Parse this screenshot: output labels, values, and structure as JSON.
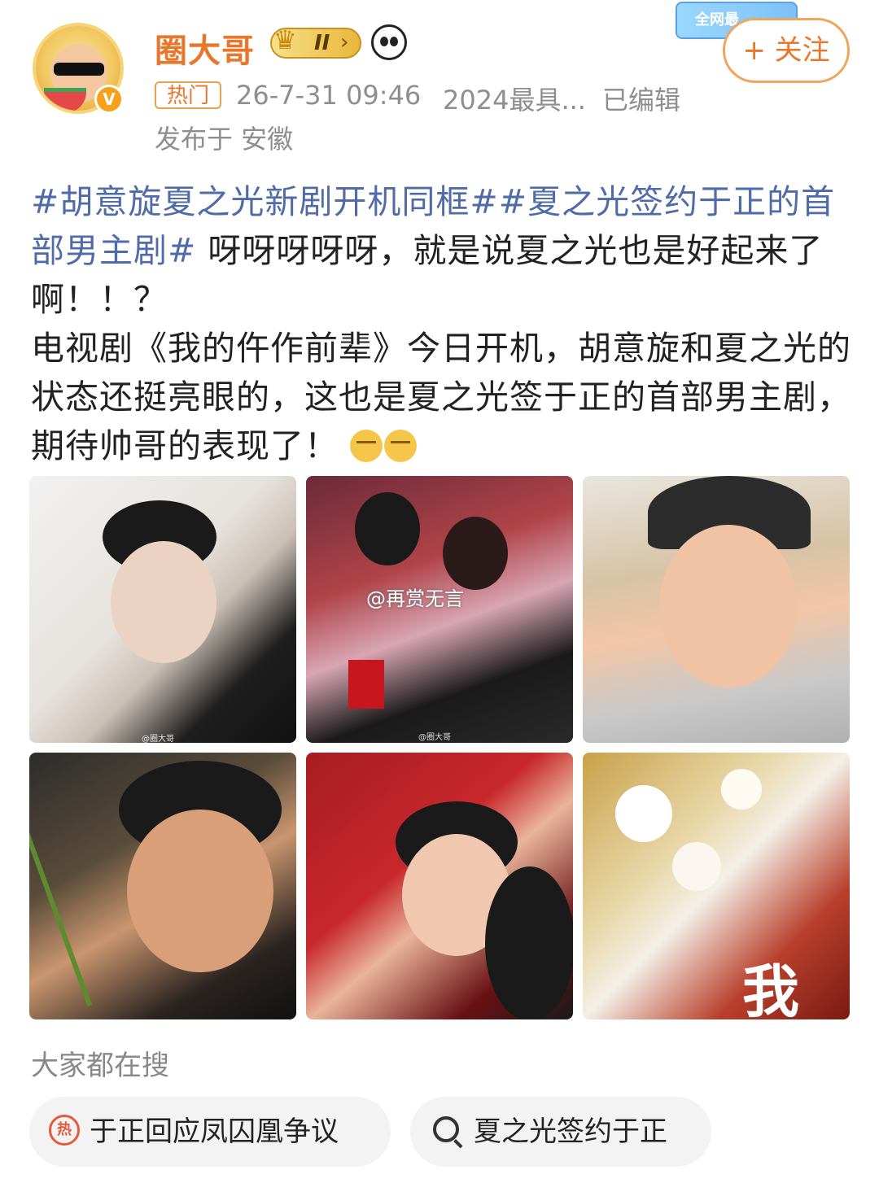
{
  "header": {
    "username": "圈大哥",
    "vip_level": "II",
    "promo_label": "全网最",
    "tag_hot": "热门",
    "timestamp": "26-7-31 09:46",
    "source": "2024最具...",
    "edited": "已编辑",
    "location": "发布于 安徽",
    "follow_label": "+ 关注"
  },
  "post": {
    "hashtag1": "#胡意旋夏之光新剧开机同框#",
    "hashtag2": "#夏之光签约于正的首部男主剧#",
    "line1_rest": " 呀呀呀呀呀，就是说夏之光也是好起来了啊！！？",
    "paragraph2": "电视剧《我的仵作前辈》今日开机，胡意旋和夏之光的状态还挺亮眼的，这也是夏之光签于正的首部男主剧，期待帅哥的表现了！"
  },
  "photos": {
    "watermark_small": "@圈大哥",
    "watermark_center": "@再赏无言",
    "poster_char": "我"
  },
  "search": {
    "title": "大家都在搜",
    "hot_icon_text": "热",
    "items": [
      "于正回应凤囚凰争议",
      "夏之光签约于正"
    ]
  },
  "colors": {
    "accent": "#e8762b",
    "hashtag": "#4f6ba8",
    "meta_gray": "#8e8e8e"
  }
}
